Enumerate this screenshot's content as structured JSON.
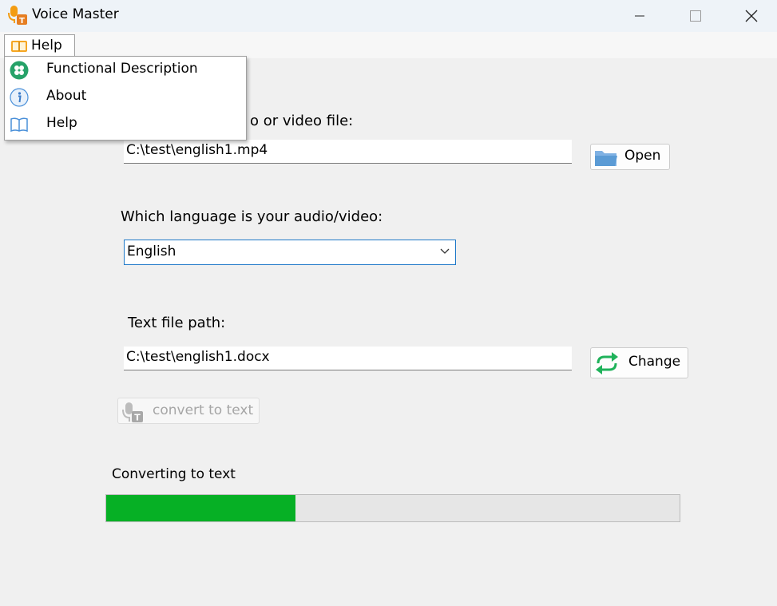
{
  "window": {
    "title": "Voice Master"
  },
  "menu": {
    "help_label": "Help",
    "items": [
      {
        "label": "Functional Description",
        "icon": "clover-icon"
      },
      {
        "label": "About",
        "icon": "info-icon"
      },
      {
        "label": "Help",
        "icon": "book-icon"
      }
    ]
  },
  "source": {
    "prompt_visible": "o or video file:",
    "path": "C:\\test\\english1.mp4",
    "open_label": "Open"
  },
  "language": {
    "prompt": "Which language is your audio/video:",
    "selected": "English"
  },
  "output": {
    "prompt": "Text file path:",
    "path": "C:\\test\\english1.docx",
    "change_label": "Change"
  },
  "convert": {
    "label": "convert to text",
    "enabled": false
  },
  "progress": {
    "status": "Converting to text",
    "fraction": 0.33
  },
  "colors": {
    "progress": "#06b025",
    "accent": "#1e78c8",
    "change_icon": "#1fb25a",
    "open_icon": "#5b9bd5"
  }
}
